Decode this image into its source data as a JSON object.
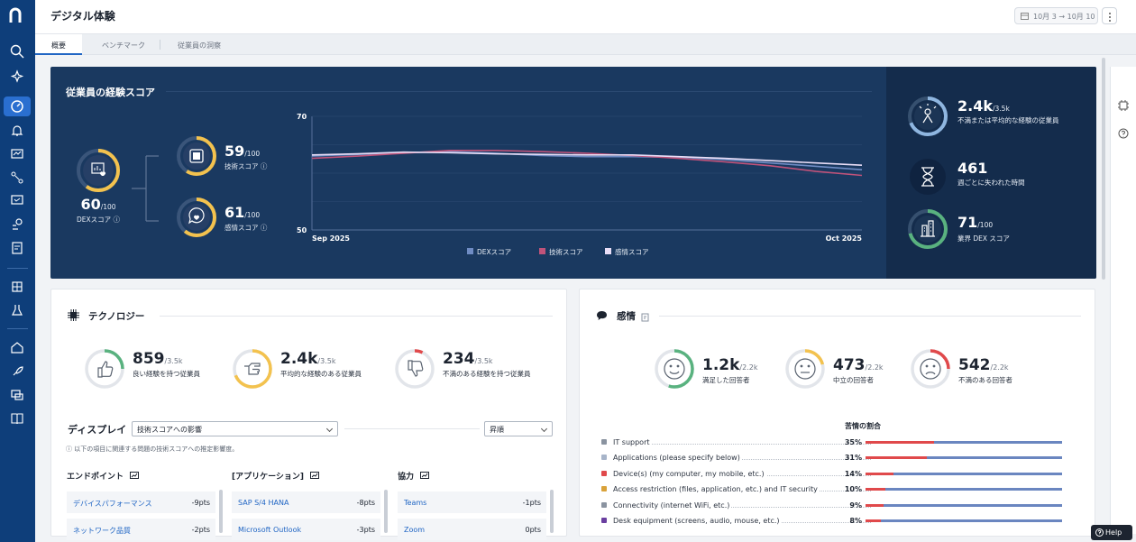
{
  "header": {
    "title": "デジタル体験",
    "date_range": "10月 3 → 10月 10"
  },
  "tabs": [
    {
      "label": "概要"
    },
    {
      "label": "ベンチマーク"
    },
    {
      "label": "従業員の洞察"
    }
  ],
  "hero": {
    "title": "従業員の経験スコア",
    "dex": {
      "value": "60",
      "denom": "/100",
      "label": "DEXスコア",
      "level": 0.6
    },
    "tech": {
      "value": "59",
      "denom": "/100",
      "label": "技術スコア",
      "level": 0.59
    },
    "sentiment": {
      "value": "61",
      "denom": "/100",
      "label": "感情スコア",
      "level": 0.61
    },
    "right": [
      {
        "value": "2.4k",
        "denom": "/3.5k",
        "label": "不満または平均的な経験の従業員",
        "level": 0.69
      },
      {
        "value": "461",
        "denom": "",
        "label": "週ごとに失われた時間"
      },
      {
        "value": "71",
        "denom": "/100",
        "label": "業界 DEX スコア",
        "level": 0.71
      }
    ]
  },
  "chart_data": {
    "type": "line",
    "x": [
      "Sep 2025",
      "Oct 2025"
    ],
    "ylim": [
      50,
      70
    ],
    "y_ticks": [
      "70",
      "50"
    ],
    "x_ticks": [
      "Sep 2025",
      "Oct 2025"
    ],
    "series": [
      {
        "name": "DEXスコア",
        "color": "#6f8cc4",
        "values": [
          63,
          63.3,
          63.6,
          63.8,
          63.5,
          63.1,
          62.9,
          62.9,
          62.8,
          62.4,
          61.8,
          61.2,
          60.6
        ]
      },
      {
        "name": "技術スコア",
        "color": "#c0537a",
        "values": [
          62.6,
          63.0,
          63.5,
          64.0,
          64.0,
          63.8,
          63.5,
          63.1,
          62.6,
          62.0,
          61.3,
          60.3,
          59.6
        ]
      },
      {
        "name": "感情スコア",
        "color": "#e9def7",
        "values": [
          63.2,
          63.4,
          63.7,
          63.6,
          63.4,
          63.3,
          63.2,
          63.2,
          62.9,
          62.6,
          62.2,
          61.8,
          61.4
        ]
      }
    ]
  },
  "technology": {
    "title": "テクノロジー",
    "stats": [
      {
        "value": "859",
        "denom": "/3.5k",
        "label": "良い経験を持つ従業員",
        "level": 0.25,
        "color": "#59b27f",
        "icon": "thumbs-up-icon"
      },
      {
        "value": "2.4k",
        "denom": "/3.5k",
        "label": "平均的な経験のある従業員",
        "level": 0.69,
        "color": "#f3c24e",
        "icon": "hand-point-icon"
      },
      {
        "value": "234",
        "denom": "/3.5k",
        "label": "不満のある経験を持つ従業員",
        "level": 0.07,
        "color": "#e0494b",
        "icon": "thumbs-down-icon"
      }
    ],
    "display_label": "ディスプレイ",
    "display_select": "技術スコアへの影響",
    "sort_select": "昇順",
    "hint": "以下の項目に関連する問題の技術スコアへの推定影響度。",
    "columns": [
      {
        "title": "エンドポイント",
        "rows": [
          {
            "name": "デバイスパフォーマンス",
            "pts": "-9pts"
          },
          {
            "name": "ネットワーク品質",
            "pts": "-2pts"
          }
        ]
      },
      {
        "title": "[アプリケーション]",
        "rows": [
          {
            "name": "SAP S/4 HANA",
            "pts": "-8pts"
          },
          {
            "name": "Microsoft Outlook",
            "pts": "-3pts"
          }
        ]
      },
      {
        "title": "協力",
        "rows": [
          {
            "name": "Teams",
            "pts": "-1pts"
          },
          {
            "name": "Zoom",
            "pts": "0pts"
          }
        ]
      }
    ]
  },
  "sentiment_card": {
    "title": "感情",
    "stats": [
      {
        "value": "1.2k",
        "denom": "/2.2k",
        "label": "満足した回答者",
        "level": 0.55,
        "color": "#59b27f",
        "icon": "smile-icon"
      },
      {
        "value": "473",
        "denom": "/2.2k",
        "label": "中立の回答者",
        "level": 0.21,
        "color": "#f3c24e",
        "icon": "neutral-face-icon"
      },
      {
        "value": "542",
        "denom": "/2.2k",
        "label": "不満のある回答者",
        "level": 0.25,
        "color": "#e0494b",
        "icon": "sad-face-icon"
      }
    ],
    "complaints_title": "苦情の割合",
    "complaints": [
      {
        "label": "IT support",
        "pct": "35%",
        "level": 0.35,
        "icon": "wrench-icon",
        "icon_color": "#8a93a0"
      },
      {
        "label": "Applications (please specify below)",
        "pct": "31%",
        "level": 0.31,
        "icon": "document-icon",
        "icon_color": "#a7b4c9"
      },
      {
        "label": "Device(s) (my computer, my mobile, etc.)",
        "pct": "14%",
        "level": 0.14,
        "icon": "phone-icon",
        "icon_color": "#e0494b"
      },
      {
        "label": "Access restriction (files, application, etc.) and IT security",
        "pct": "10%",
        "level": 0.1,
        "icon": "lock-icon",
        "icon_color": "#d9a23a"
      },
      {
        "label": "Connectivity (internet WiFi, etc.)",
        "pct": "9%",
        "level": 0.09,
        "icon": "connectivity-icon",
        "icon_color": "#8a93a0"
      },
      {
        "label": "Desk equipment (screens, audio, mouse, etc.)",
        "pct": "8%",
        "level": 0.08,
        "icon": "equipment-icon",
        "icon_color": "#6a3fa0"
      }
    ]
  },
  "help_label": "Help"
}
